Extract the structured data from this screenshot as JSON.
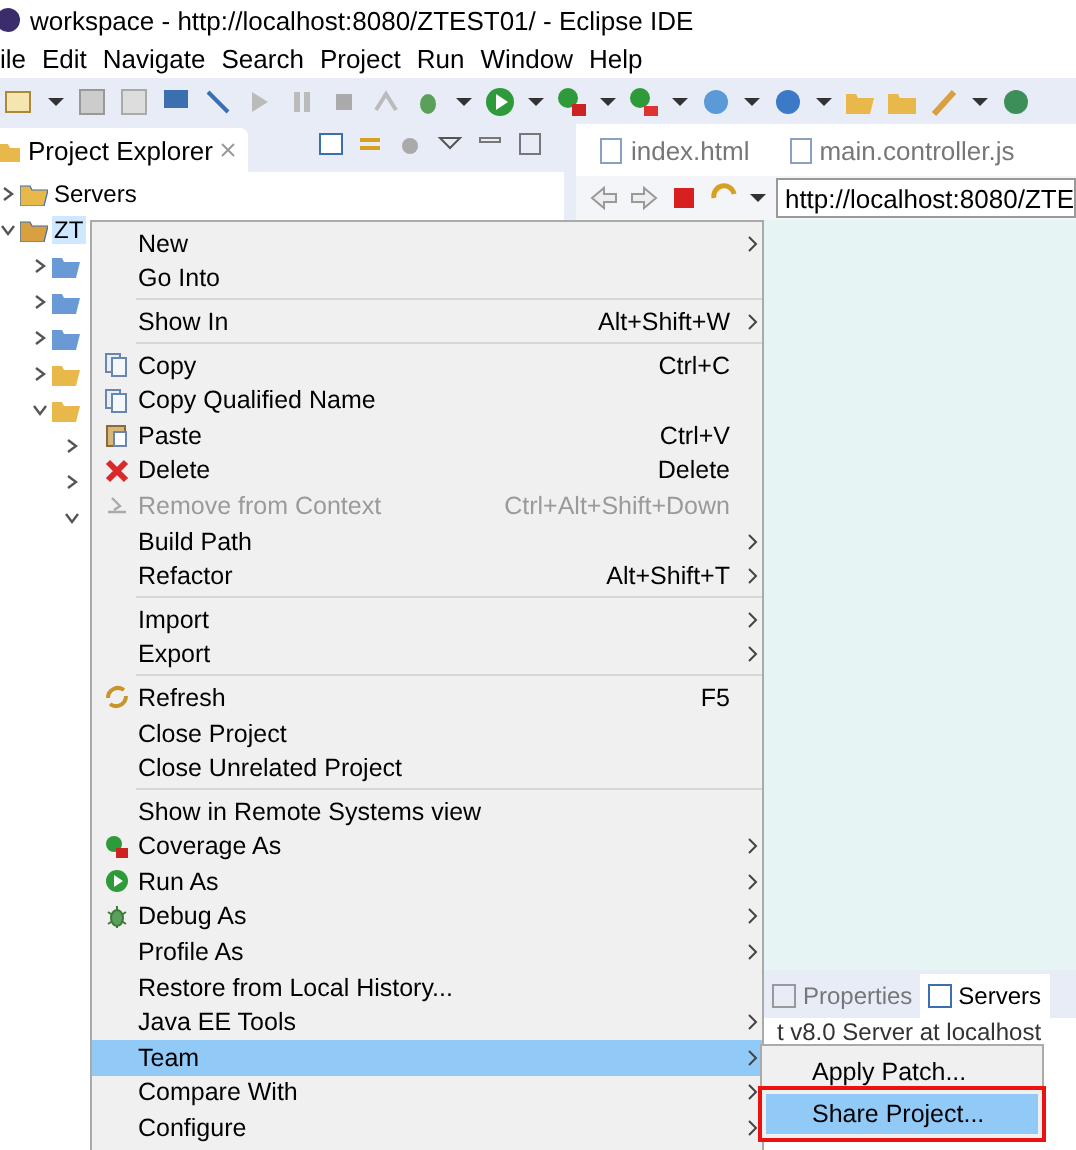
{
  "window": {
    "title": "workspace - http://localhost:8080/ZTEST01/ - Eclipse IDE"
  },
  "menu_bar": [
    "ile",
    "Edit",
    "Navigate",
    "Search",
    "Project",
    "Run",
    "Window",
    "Help"
  ],
  "project_explorer": {
    "title": "Project Explorer",
    "items": [
      {
        "label": "Servers",
        "expanded": false,
        "selected": false
      },
      {
        "label": "ZT",
        "expanded": true,
        "selected": true
      }
    ]
  },
  "editor_tabs": [
    {
      "label": "index.html",
      "selected": false
    },
    {
      "label": "main.controller.js",
      "selected": false
    }
  ],
  "browser": {
    "url": "http://localhost:8080/ZTE"
  },
  "bottom_tabs": [
    {
      "label": "Properties",
      "selected": false
    },
    {
      "label": "Servers",
      "selected": true
    }
  ],
  "server_row": "t v8.0 Server at localhost",
  "context_menu": [
    {
      "kind": "item",
      "label": "New",
      "submenu": true
    },
    {
      "kind": "item",
      "label": "Go Into"
    },
    {
      "kind": "separator"
    },
    {
      "kind": "item",
      "label": "Show In",
      "shortcut": "Alt+Shift+W",
      "submenu": true
    },
    {
      "kind": "separator"
    },
    {
      "kind": "item",
      "label": "Copy",
      "shortcut": "Ctrl+C"
    },
    {
      "kind": "item",
      "label": "Copy Qualified Name"
    },
    {
      "kind": "item",
      "label": "Paste",
      "shortcut": "Ctrl+V"
    },
    {
      "kind": "item",
      "label": "Delete",
      "shortcut": "Delete"
    },
    {
      "kind": "item",
      "label": "Remove from Context",
      "shortcut": "Ctrl+Alt+Shift+Down",
      "disabled": true
    },
    {
      "kind": "item",
      "label": "Build Path",
      "submenu": true
    },
    {
      "kind": "item",
      "label": "Refactor",
      "shortcut": "Alt+Shift+T",
      "submenu": true
    },
    {
      "kind": "separator"
    },
    {
      "kind": "item",
      "label": "Import",
      "submenu": true
    },
    {
      "kind": "item",
      "label": "Export",
      "submenu": true
    },
    {
      "kind": "separator"
    },
    {
      "kind": "item",
      "label": "Refresh",
      "shortcut": "F5"
    },
    {
      "kind": "item",
      "label": "Close Project"
    },
    {
      "kind": "item",
      "label": "Close Unrelated Project"
    },
    {
      "kind": "separator"
    },
    {
      "kind": "item",
      "label": "Show in Remote Systems view"
    },
    {
      "kind": "item",
      "label": "Coverage As",
      "submenu": true
    },
    {
      "kind": "item",
      "label": "Run As",
      "submenu": true
    },
    {
      "kind": "item",
      "label": "Debug As",
      "submenu": true
    },
    {
      "kind": "item",
      "label": "Profile As",
      "submenu": true
    },
    {
      "kind": "item",
      "label": "Restore from Local History..."
    },
    {
      "kind": "item",
      "label": "Java EE Tools",
      "submenu": true
    },
    {
      "kind": "item",
      "label": "Team",
      "submenu": true,
      "selected": true
    },
    {
      "kind": "item",
      "label": "Compare With",
      "submenu": true
    },
    {
      "kind": "item",
      "label": "Configure",
      "submenu": true
    }
  ],
  "team_submenu": [
    {
      "label": "Apply Patch...",
      "selected": false,
      "highlighted": false
    },
    {
      "label": "Share Project...",
      "selected": true,
      "highlighted": true
    }
  ]
}
